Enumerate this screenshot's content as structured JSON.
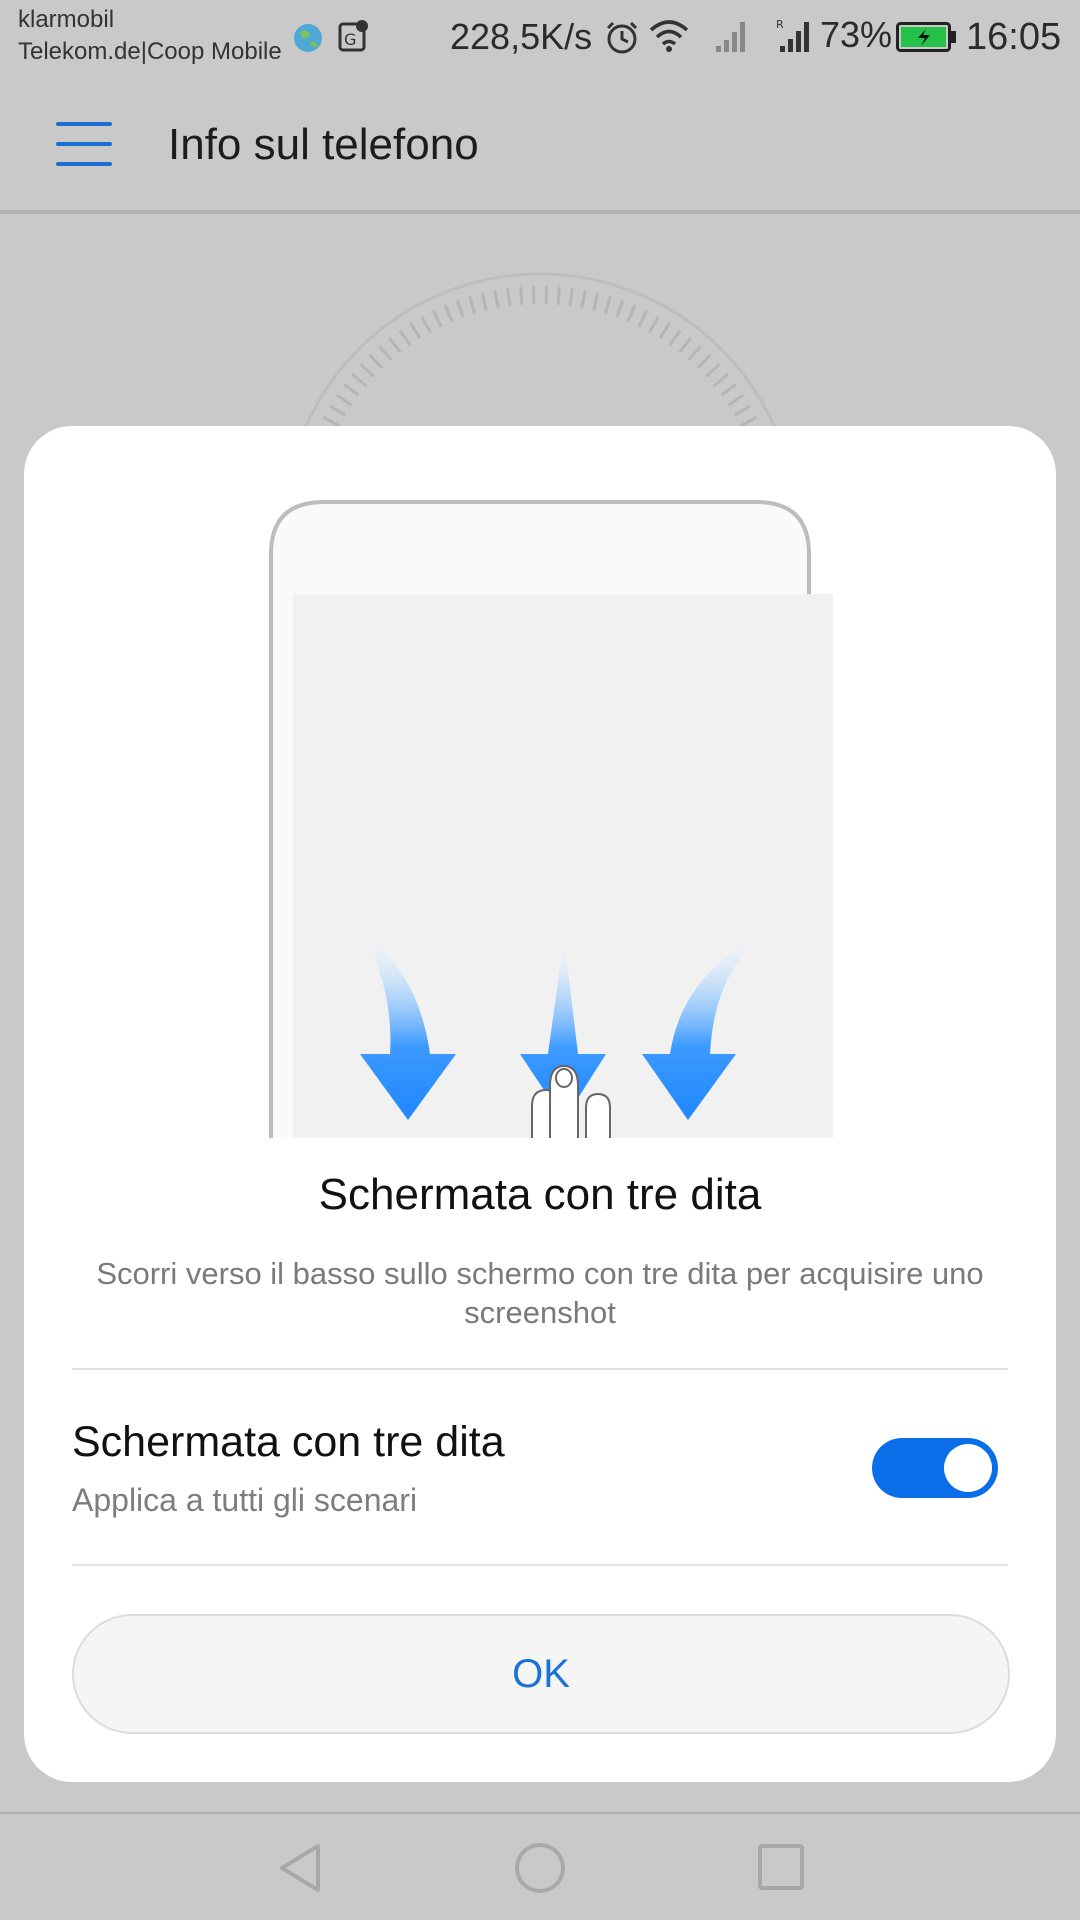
{
  "status_bar": {
    "carrier_primary": "klarmobil",
    "carrier_secondary": "Telekom.de|Coop Mobile",
    "network_speed": "228,5K/s",
    "battery_percent": "73%",
    "time": "16:05",
    "icons": [
      "globe-icon",
      "map-pin-icon",
      "alarm-icon",
      "wifi-icon",
      "signal-icon",
      "signal-roaming-icon",
      "battery-charging-icon"
    ]
  },
  "app_bar": {
    "title": "Info sul telefono",
    "menu_icon": "hamburger-menu-icon"
  },
  "dialog": {
    "title": "Schermata con tre dita",
    "description": "Scorri verso il basso sullo schermo con tre dita per acquisire uno screenshot",
    "setting": {
      "title": "Schermata con tre dita",
      "subtitle": "Applica a tutti gli scenari",
      "enabled": true
    },
    "ok_label": "OK"
  },
  "navigation": {
    "icons": [
      "back-icon",
      "home-icon",
      "recents-icon"
    ]
  },
  "colors": {
    "accent": "#0a6ee8",
    "scrim": "#c9c9c9",
    "arrow": "#3d9bff"
  }
}
